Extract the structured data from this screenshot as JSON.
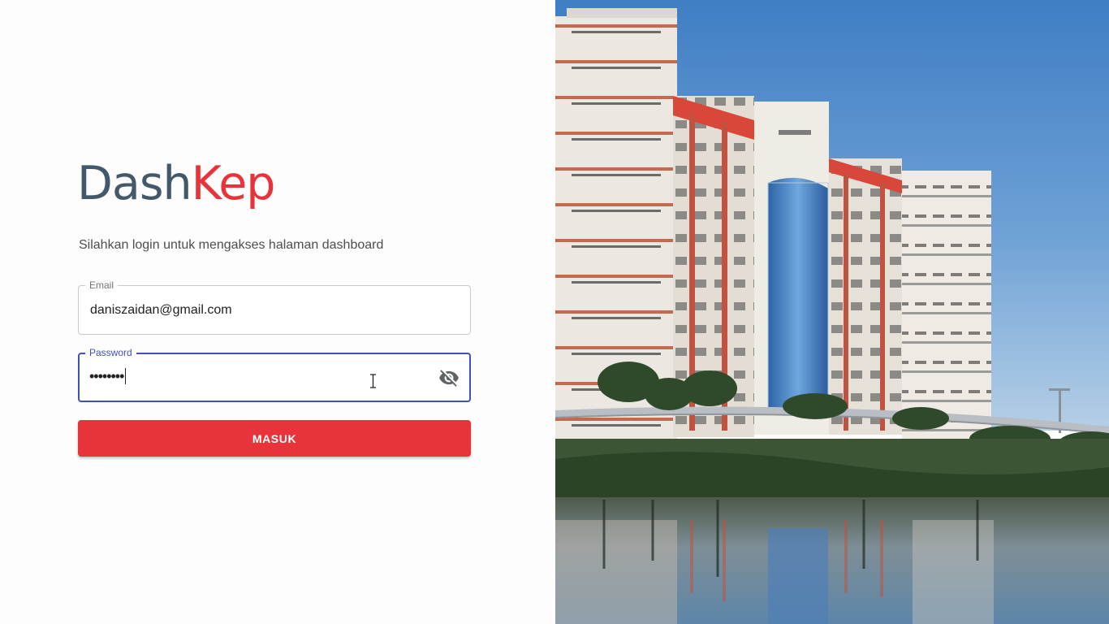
{
  "brand": {
    "part1": "Dash",
    "part2": "Kep"
  },
  "subtitle": "Silahkan login untuk mengakses halaman dashboard",
  "form": {
    "email": {
      "label": "Email",
      "value": "daniszaidan@gmail.com"
    },
    "password": {
      "label": "Password",
      "masked_value": "••••••••",
      "visibility_icon": "eye-off-icon"
    },
    "submit_label": "MASUK"
  },
  "colors": {
    "brand_dark": "#44586b",
    "brand_red": "#e8333a",
    "focus_blue": "#3f51b5"
  },
  "photo": {
    "subject": "campus-building-with-lake-reflection"
  }
}
